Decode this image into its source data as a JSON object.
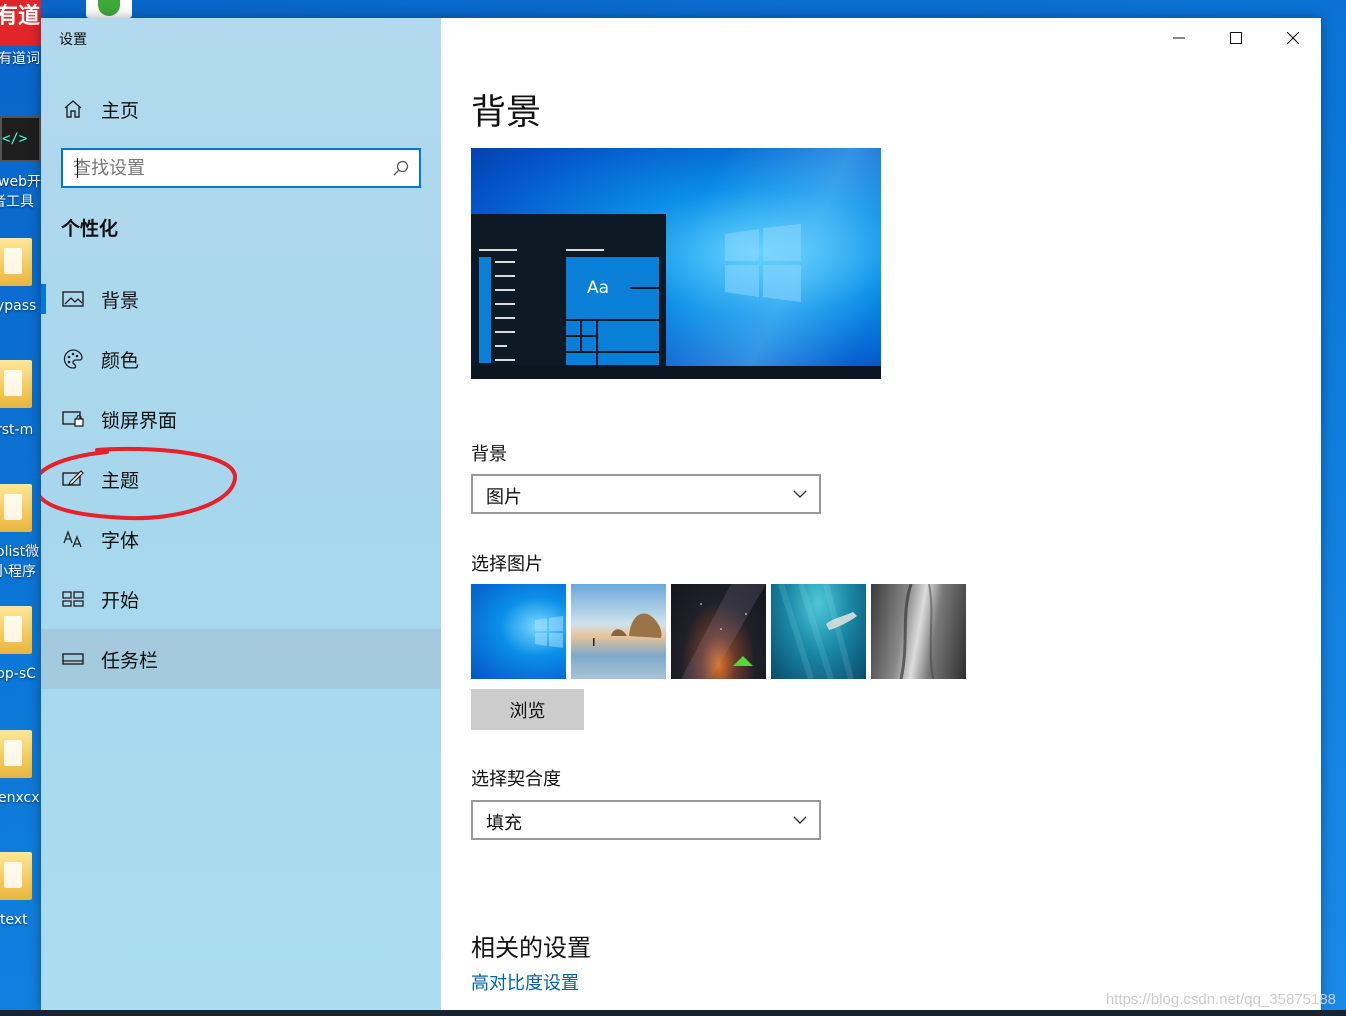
{
  "desktop": {
    "icons": [
      {
        "label": "有道词",
        "logo": "有道"
      },
      {
        "label": "web开",
        "label2": "者工具",
        "logo": "</>"
      },
      {
        "label": "ypass"
      },
      {
        "label": "rst-m"
      },
      {
        "label": "olist微",
        "label2": "小程序"
      },
      {
        "label": "pp-sC"
      },
      {
        "label": "enxcx"
      },
      {
        "label": "text"
      }
    ]
  },
  "window": {
    "app_title": "设置",
    "controls": {
      "minimize": "minimize-icon",
      "maximize": "maximize-icon",
      "close": "close-icon"
    }
  },
  "sidebar": {
    "home_label": "主页",
    "search_placeholder": "查找设置",
    "section_title": "个性化",
    "items": [
      {
        "label": "背景",
        "icon": "picture-icon",
        "active": true
      },
      {
        "label": "颜色",
        "icon": "palette-icon"
      },
      {
        "label": "锁屏界面",
        "icon": "lock-screen-icon"
      },
      {
        "label": "主题",
        "icon": "theme-icon"
      },
      {
        "label": "字体",
        "icon": "font-icon"
      },
      {
        "label": "开始",
        "icon": "start-icon"
      },
      {
        "label": "任务栏",
        "icon": "taskbar-icon",
        "hovered": true
      }
    ]
  },
  "content": {
    "page_title": "背景",
    "preview_tile_text": "Aa",
    "background_label": "背景",
    "background_value": "图片",
    "choose_picture_label": "选择图片",
    "browse_label": "浏览",
    "fit_label": "选择契合度",
    "fit_value": "填充",
    "related_title": "相关的设置",
    "related_link": "高对比度设置"
  },
  "watermark": "https://blog.csdn.net/qq_35875188",
  "colors": {
    "accent": "#0078d7",
    "annotation": "#e8202a",
    "link": "#0063b1"
  }
}
